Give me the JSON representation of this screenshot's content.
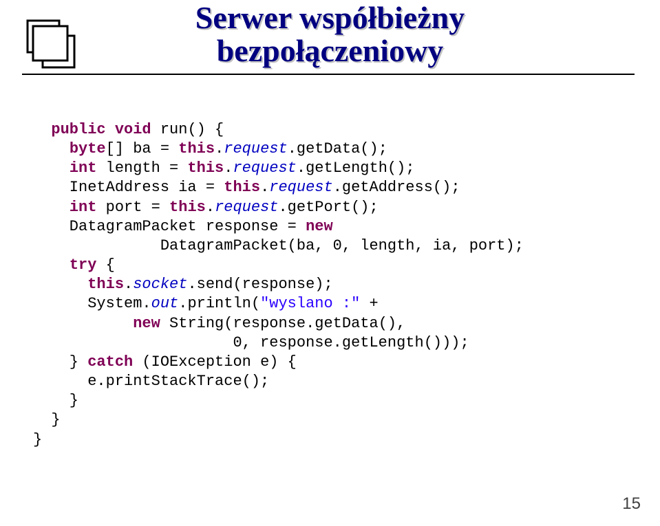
{
  "title": {
    "line1": "Serwer współbieżny",
    "line2": "bezpołączeniowy"
  },
  "code": {
    "l01a": "  ",
    "l01_kw1": "public",
    "l01b": " ",
    "l01_kw2": "void",
    "l01c": " run() {",
    "l02a": "    ",
    "l02_kw": "byte",
    "l02b": "[] ba = ",
    "l02_kw2": "this",
    "l02c": ".",
    "l02_fld": "request",
    "l02d": ".getData();",
    "l03a": "    ",
    "l03_kw": "int",
    "l03b": " length = ",
    "l03_kw2": "this",
    "l03c": ".",
    "l03_fld": "request",
    "l03d": ".getLength();",
    "l04a": "    InetAddress ia = ",
    "l04_kw": "this",
    "l04b": ".",
    "l04_fld": "request",
    "l04c": ".getAddress();",
    "l05a": "    ",
    "l05_kw": "int",
    "l05b": " port = ",
    "l05_kw2": "this",
    "l05c": ".",
    "l05_fld": "request",
    "l05d": ".getPort();",
    "l06a": "    DatagramPacket response = ",
    "l06_kw": "new",
    "l07a": "              DatagramPacket(ba, 0, length, ia, port);",
    "l08a": "    ",
    "l08_kw": "try",
    "l08b": " {",
    "l09a": "      ",
    "l09_kw": "this",
    "l09b": ".",
    "l09_fld": "socket",
    "l09c": ".send(response);",
    "l10a": "      System.",
    "l10_fld": "out",
    "l10b": ".println(",
    "l10_str": "\"wyslano :\"",
    "l10c": " +",
    "l11a": "           ",
    "l11_kw": "new",
    "l11b": " String(response.getData(),",
    "l12a": "                      0, response.getLength()));",
    "l13a": "    } ",
    "l13_kw": "catch",
    "l13b": " (IOException e) {",
    "l14a": "      e.printStackTrace();",
    "l15a": "    }",
    "l16a": "  }",
    "l17a": "}"
  },
  "page_number": "15"
}
